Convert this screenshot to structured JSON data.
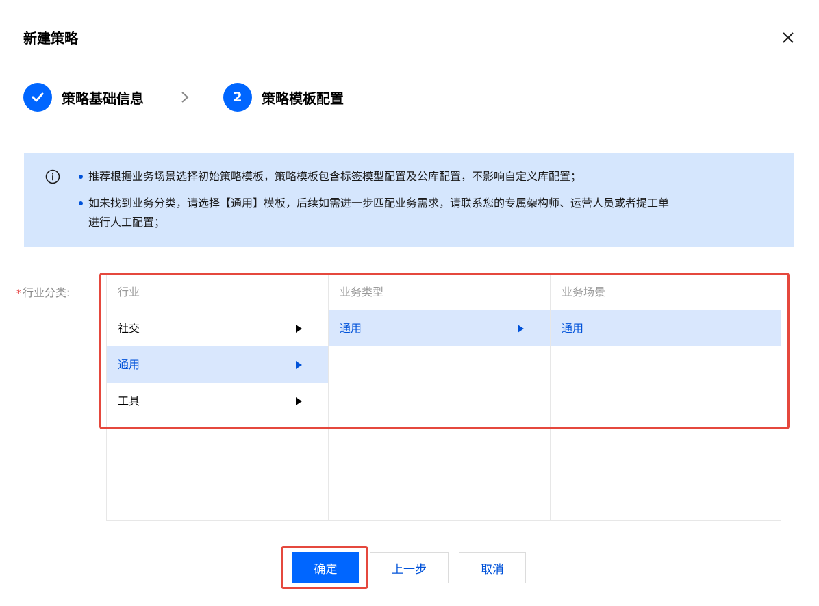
{
  "dialog": {
    "title": "新建策略"
  },
  "steps": [
    {
      "label": "策略基础信息",
      "status": "done"
    },
    {
      "number": "2",
      "label": "策略模板配置",
      "status": "current"
    }
  ],
  "alert": {
    "items": [
      {
        "lines": [
          "推荐根据业务场景选择初始策略模板，策略模板包含标签模型配置及公库配置，不影响自定义库配置；"
        ]
      },
      {
        "lines": [
          "如未找到业务分类，请选择【通用】模板，后续如需进一步匹配业务需求，请联系您的专属架构师、运营人员或者提工单",
          "进行人工配置；"
        ]
      }
    ]
  },
  "form": {
    "industry_label": "行业分类:",
    "required_mark": "*"
  },
  "cascader": {
    "columns": [
      {
        "header": "行业",
        "options": [
          {
            "label": "社交",
            "active": false,
            "has_children": true
          },
          {
            "label": "通用",
            "active": true,
            "has_children": true
          },
          {
            "label": "工具",
            "active": false,
            "has_children": true
          }
        ]
      },
      {
        "header": "业务类型",
        "options": [
          {
            "label": "通用",
            "active": true,
            "has_children": true
          }
        ]
      },
      {
        "header": "业务场景",
        "options": [
          {
            "label": "通用",
            "active": true,
            "has_children": false
          }
        ]
      }
    ]
  },
  "buttons": {
    "confirm": "确定",
    "prev": "上一步",
    "cancel": "取消"
  },
  "colors": {
    "primary": "#0066ff",
    "alert_bg": "#d5e6fd",
    "active_option_bg": "#d9e7fd",
    "highlight": "#e5483d"
  }
}
